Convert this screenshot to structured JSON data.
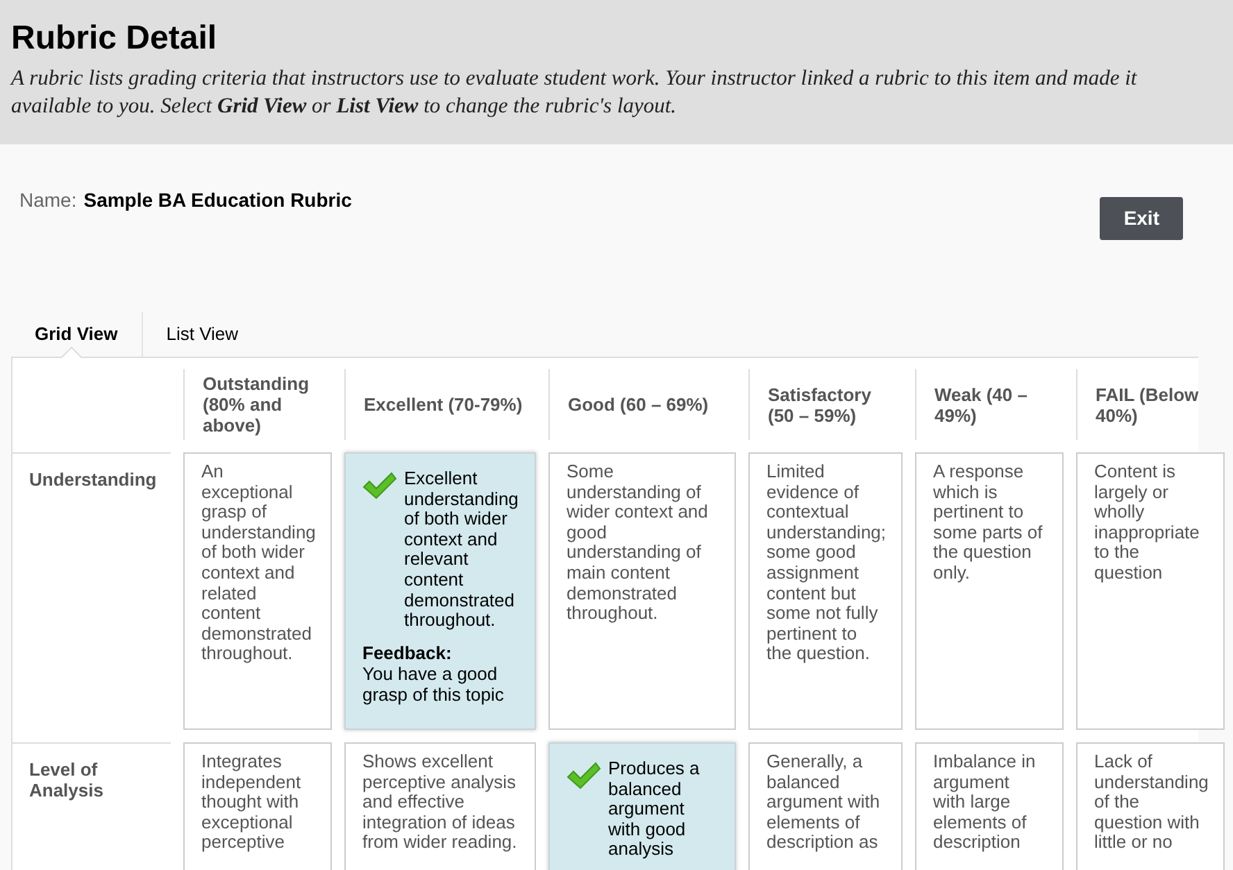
{
  "page": {
    "title": "Rubric Detail",
    "description": "A rubric lists grading criteria that instructors use to evaluate student work. Your instructor linked a rubric to this item and made it available to you. Select **Grid View** or **List View** to change the rubric's layout."
  },
  "rubric_name": {
    "label": "Name:",
    "value": "Sample BA Education Rubric"
  },
  "exit_button": "Exit",
  "tabs": [
    {
      "label": "Grid View",
      "selected": true
    },
    {
      "label": "List View",
      "selected": false
    }
  ],
  "columns": [
    "Outstanding (80% and above)",
    "Excellent (70-79%)",
    "Good (60 – 69%)",
    "Satisfactory (50 – 59%)",
    "Weak (40 – 49%)",
    "FAIL (Below 40%)"
  ],
  "rows": [
    {
      "criterion": "Understanding",
      "cells": [
        {
          "text": "An exceptional grasp of understanding of both wider context and related content demonstrated throughout.",
          "selected": false
        },
        {
          "text": "Excellent understanding of both wider context and relevant content demonstrated throughout.",
          "selected": true,
          "feedback_label": "Feedback:",
          "feedback": "You have a good grasp of this topic"
        },
        {
          "text": "Some understanding of wider context and good understanding of main content demonstrated throughout.",
          "selected": false
        },
        {
          "text": "Limited evidence of contextual understanding; some good assignment content but some not fully pertinent to the question.",
          "selected": false
        },
        {
          "text": "A response which is pertinent to some parts of the question only.",
          "selected": false
        },
        {
          "text": "Content is largely or wholly inappropriate to the question",
          "selected": false
        }
      ]
    },
    {
      "criterion": "Level of Analysis",
      "cells": [
        {
          "text": "Integrates independent thought with exceptional perceptive",
          "selected": false
        },
        {
          "text": "Shows excellent perceptive analysis and effective integration of ideas from wider reading.",
          "selected": false
        },
        {
          "text": "Produces a balanced argument with good analysis",
          "selected": true
        },
        {
          "text": "Generally, a balanced argument with elements of description as",
          "selected": false
        },
        {
          "text": "Imbalance in argument with large elements of description",
          "selected": false
        },
        {
          "text": "Lack of understanding of the question with little or no",
          "selected": false
        }
      ]
    }
  ]
}
